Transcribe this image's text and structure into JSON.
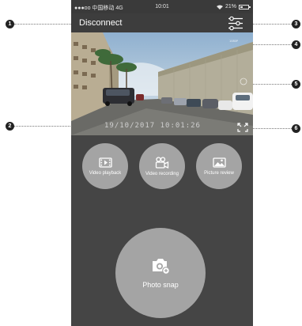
{
  "status_bar": {
    "carrier": "●●●oo 中国移动  4G",
    "time": "10:01",
    "battery": "21%"
  },
  "nav": {
    "disconnect_label": "Disconnect",
    "settings_icon": "sliders-icon"
  },
  "preview": {
    "timestamp": "19/10/2017  10:01:26",
    "fullscreen_icon": "expand-icon"
  },
  "actions": {
    "video_playback": "Video playback",
    "video_recording": "Video recording",
    "picture_review": "Picture review",
    "photo_snap": "Photo snap"
  },
  "callouts": {
    "c1": "1",
    "c2": "2",
    "c3": "3",
    "c4": "4",
    "c5": "5",
    "c6": "6"
  }
}
